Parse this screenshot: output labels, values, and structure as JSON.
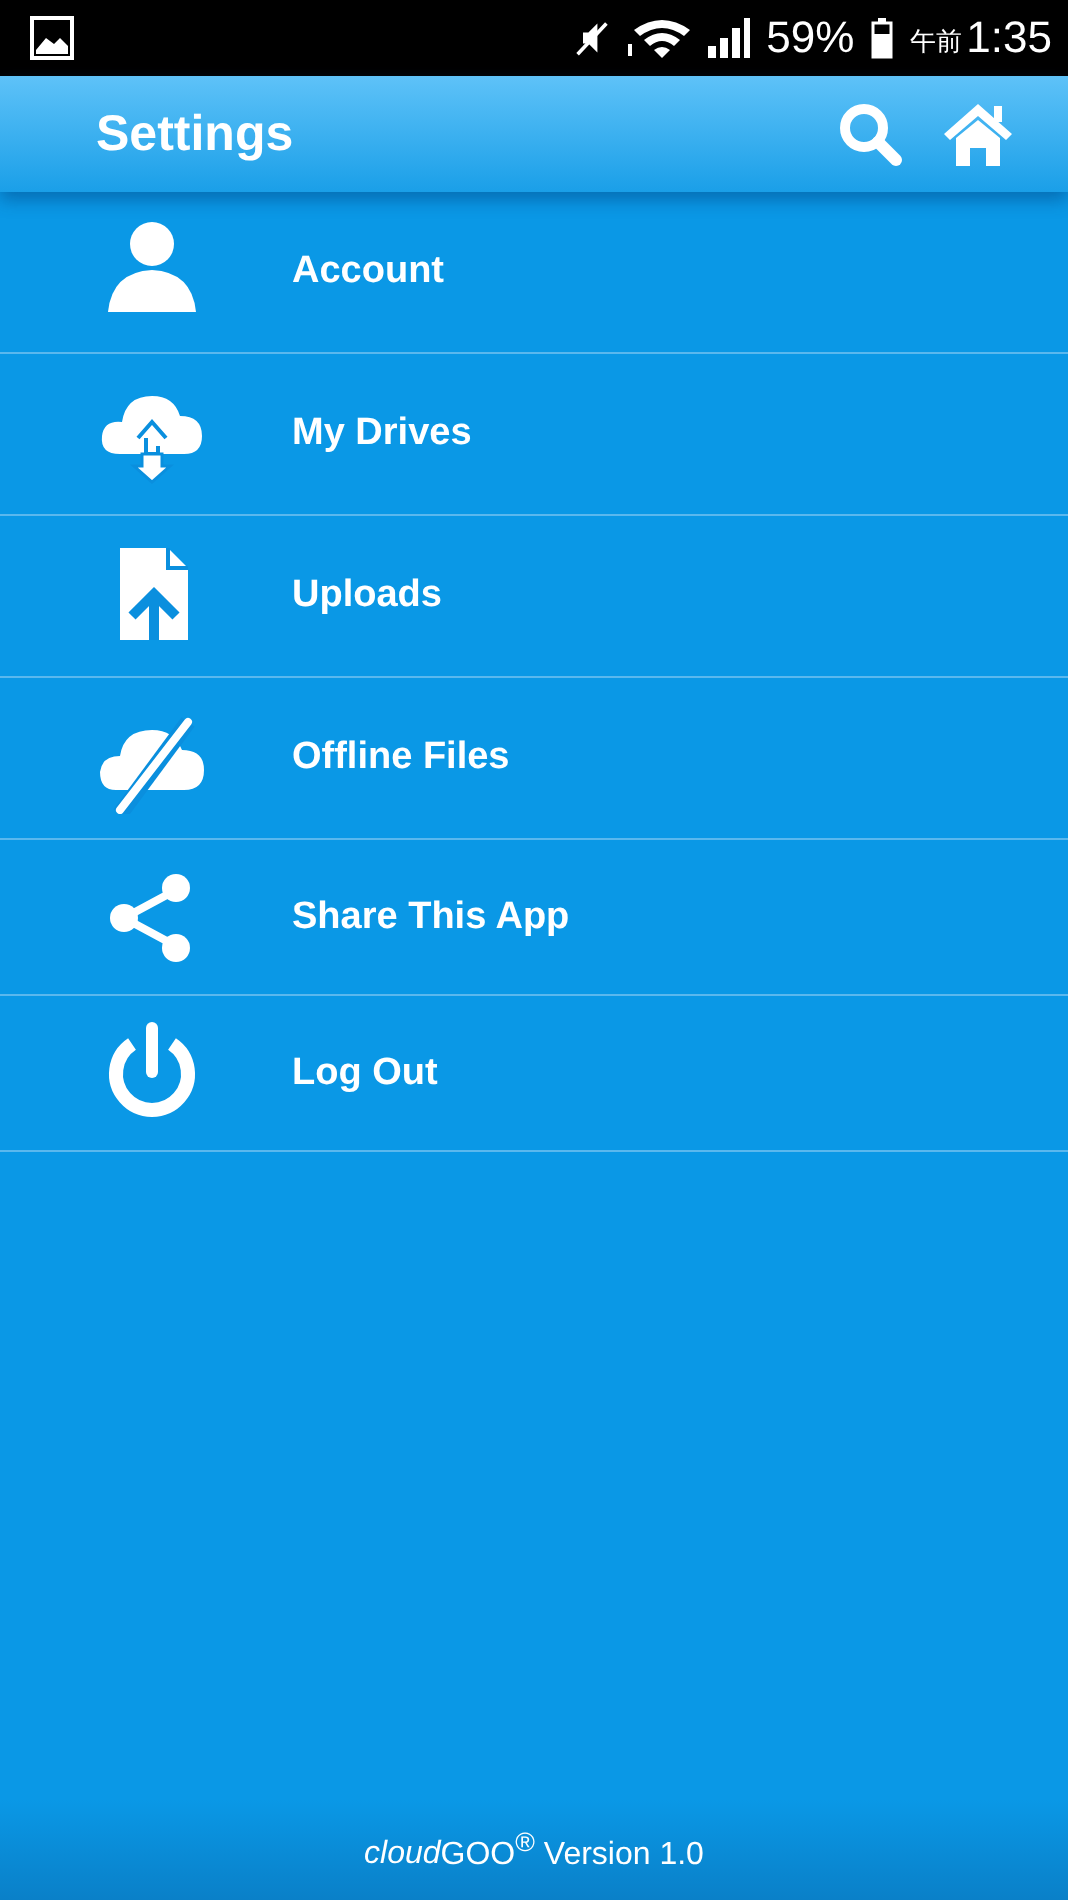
{
  "status_bar": {
    "battery": "59%",
    "time_prefix": "午前",
    "time": "1:35"
  },
  "header": {
    "title": "Settings"
  },
  "menu": [
    {
      "kind": "account",
      "label": "Account"
    },
    {
      "kind": "drives",
      "label": "My Drives"
    },
    {
      "kind": "uploads",
      "label": "Uploads"
    },
    {
      "kind": "offline",
      "label": "Offline Files"
    },
    {
      "kind": "share",
      "label": "Share This App"
    },
    {
      "kind": "logout",
      "label": "Log Out"
    }
  ],
  "footer": {
    "brand_italic": "cloud",
    "version": "GOO$^{®}$ Version 1.0"
  }
}
